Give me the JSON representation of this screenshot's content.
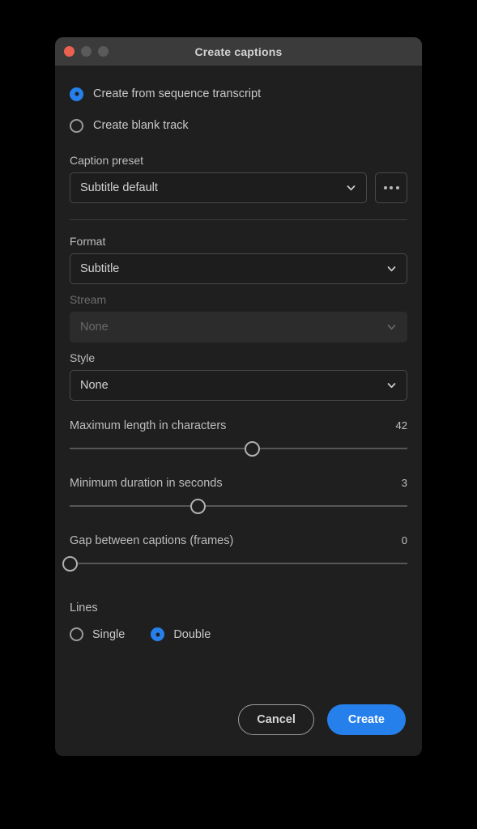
{
  "window": {
    "title": "Create captions",
    "traffic_lights": [
      "close",
      "minimize",
      "maximize"
    ]
  },
  "source_options": {
    "from_transcript_label": "Create from sequence transcript",
    "blank_track_label": "Create blank track",
    "selected": "from_transcript"
  },
  "caption_preset": {
    "label": "Caption preset",
    "value": "Subtitle default",
    "more_button_label": "•••"
  },
  "format": {
    "label": "Format",
    "value": "Subtitle",
    "disabled": false
  },
  "stream": {
    "label": "Stream",
    "value": "None",
    "disabled": true
  },
  "style": {
    "label": "Style",
    "value": "None",
    "disabled": false
  },
  "sliders": [
    {
      "name": "Maximum length in characters",
      "value": "42",
      "percent": 54
    },
    {
      "name": "Minimum duration in seconds",
      "value": "3",
      "percent": 38
    },
    {
      "name": "Gap between captions (frames)",
      "value": "0",
      "percent": 0
    }
  ],
  "lines": {
    "label": "Lines",
    "single_label": "Single",
    "double_label": "Double",
    "selected": "double"
  },
  "footer": {
    "cancel_label": "Cancel",
    "create_label": "Create"
  },
  "colors": {
    "accent": "#2680eb",
    "dialog_bg": "#1f1f1f",
    "titlebar_bg": "#3b3b3b",
    "close_button": "#eb6150",
    "desktop_bg": "#000000"
  }
}
